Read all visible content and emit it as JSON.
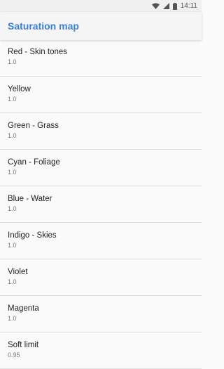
{
  "status_bar": {
    "time": "14:11",
    "icons": [
      "wifi-icon",
      "signal-icon",
      "battery-icon"
    ]
  },
  "app_bar": {
    "title": "Saturation map",
    "title_color": "#3b7fd6"
  },
  "settings": [
    {
      "label": "Red - Skin tones",
      "value": "1.0"
    },
    {
      "label": "Yellow",
      "value": "1.0"
    },
    {
      "label": "Green - Grass",
      "value": "1.0"
    },
    {
      "label": "Cyan - Foliage",
      "value": "1.0"
    },
    {
      "label": "Blue - Water",
      "value": "1.0"
    },
    {
      "label": "Indigo - Skies",
      "value": "1.0"
    },
    {
      "label": "Violet",
      "value": "1.0"
    },
    {
      "label": "Magenta",
      "value": "1.0"
    },
    {
      "label": "Soft limit",
      "value": "0.95"
    }
  ]
}
